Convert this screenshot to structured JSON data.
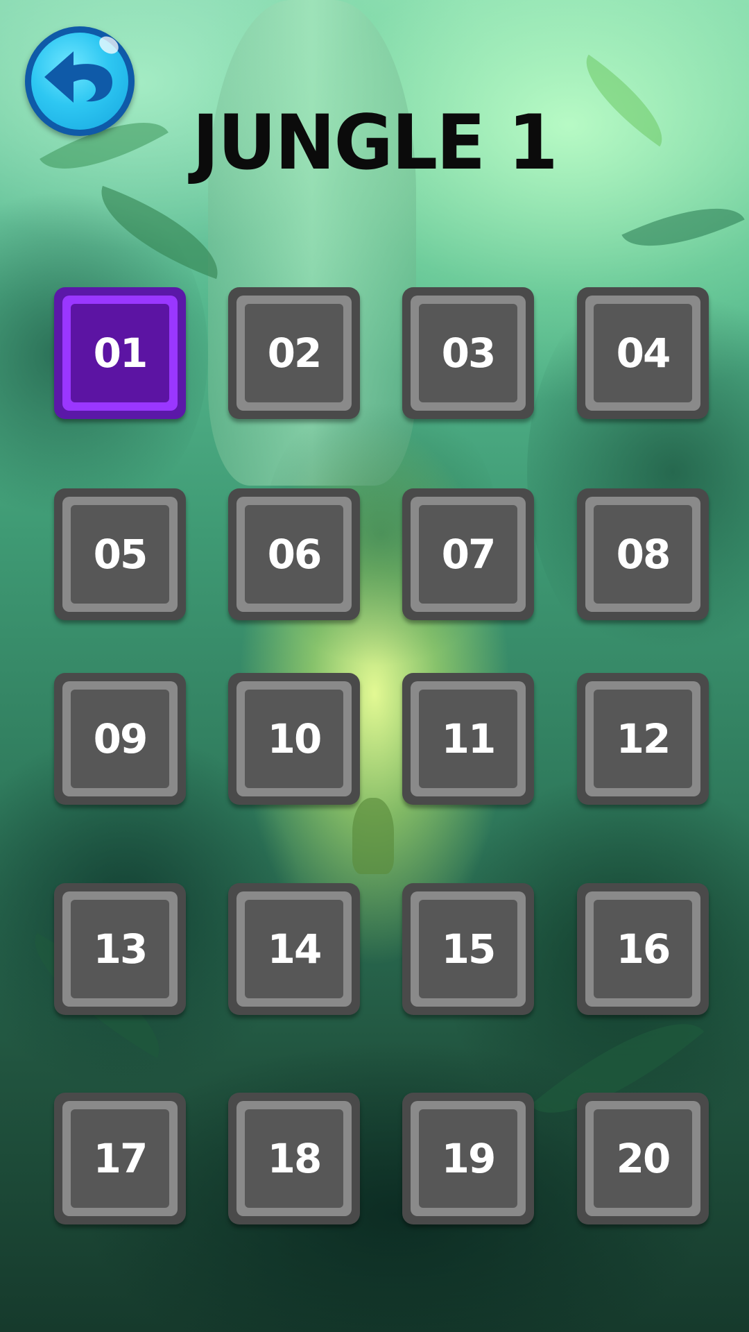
{
  "screen": {
    "title": "JUNGLE 1"
  },
  "back_button": {
    "icon": "back-arrow-icon"
  },
  "colors": {
    "tile_locked": "#575757",
    "tile_selected": "#5c14a3",
    "tile_selected_border": "#9a37ff",
    "back_button": "#2ec7f2",
    "title": "#0b0b0b"
  },
  "levels": [
    {
      "label": "01",
      "selected": true
    },
    {
      "label": "02",
      "selected": false
    },
    {
      "label": "03",
      "selected": false
    },
    {
      "label": "04",
      "selected": false
    },
    {
      "label": "05",
      "selected": false
    },
    {
      "label": "06",
      "selected": false
    },
    {
      "label": "07",
      "selected": false
    },
    {
      "label": "08",
      "selected": false
    },
    {
      "label": "09",
      "selected": false
    },
    {
      "label": "10",
      "selected": false
    },
    {
      "label": "11",
      "selected": false
    },
    {
      "label": "12",
      "selected": false
    },
    {
      "label": "13",
      "selected": false
    },
    {
      "label": "14",
      "selected": false
    },
    {
      "label": "15",
      "selected": false
    },
    {
      "label": "16",
      "selected": false
    },
    {
      "label": "17",
      "selected": false
    },
    {
      "label": "18",
      "selected": false
    },
    {
      "label": "19",
      "selected": false
    },
    {
      "label": "20",
      "selected": false
    }
  ]
}
